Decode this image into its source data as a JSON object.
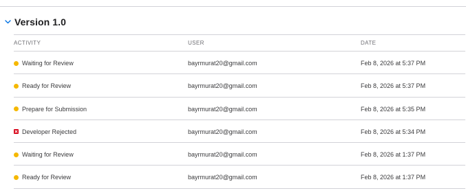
{
  "section": {
    "title": "Version 1.0",
    "expanded": true
  },
  "table": {
    "columns": {
      "activity": "ACTIVITY",
      "user": "USER",
      "date": "DATE"
    },
    "rows": [
      {
        "activity": "Waiting for Review",
        "status": "pending",
        "user": "bayrmurat20@gmail.com",
        "date": "Feb 8, 2026 at 5:37 PM"
      },
      {
        "activity": "Ready for Review",
        "status": "pending",
        "user": "bayrmurat20@gmail.com",
        "date": "Feb 8, 2026 at 5:37 PM"
      },
      {
        "activity": "Prepare for Submission",
        "status": "pending",
        "user": "bayrmurat20@gmail.com",
        "date": "Feb 8, 2026 at 5:35 PM"
      },
      {
        "activity": "Developer Rejected",
        "status": "rejected",
        "user": "bayrmurat20@gmail.com",
        "date": "Feb 8, 2026 at 5:34 PM"
      },
      {
        "activity": "Waiting for Review",
        "status": "pending",
        "user": "bayrmurat20@gmail.com",
        "date": "Feb 8, 2026 at 1:37 PM"
      },
      {
        "activity": "Ready for Review",
        "status": "pending",
        "user": "bayrmurat20@gmail.com",
        "date": "Feb 8, 2026 at 1:37 PM"
      }
    ]
  },
  "colors": {
    "pending": "#f5b800",
    "rejected": "#d70015",
    "accent": "#0071e3"
  }
}
